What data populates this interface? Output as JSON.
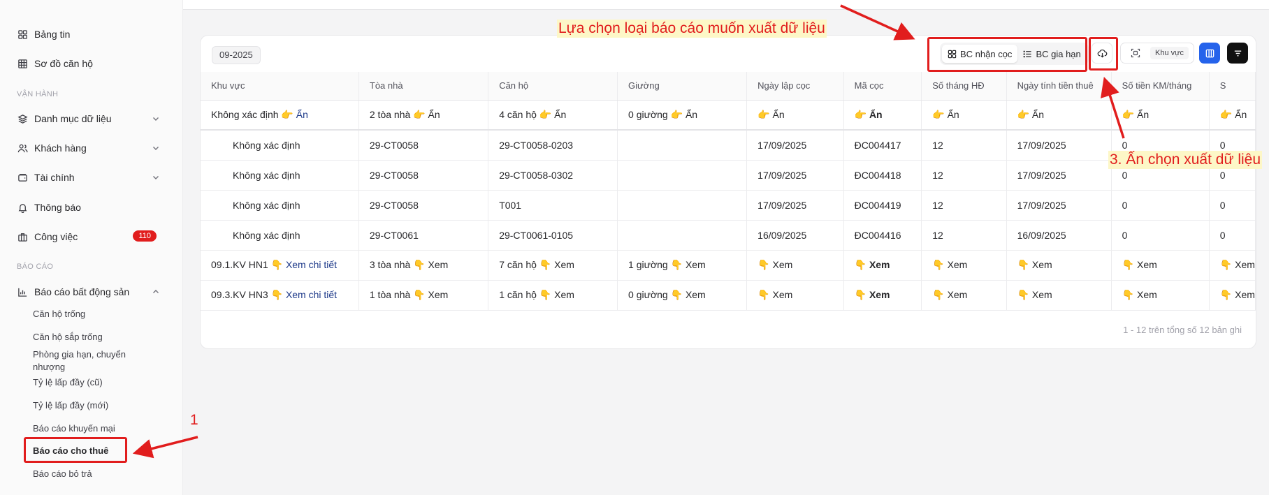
{
  "sidebar": {
    "items": [
      {
        "label": "Bảng tin"
      },
      {
        "label": "Sơ đồ căn hộ"
      }
    ],
    "sections": {
      "operations": "VẬN HÀNH",
      "reports": "BÁO CÁO"
    },
    "ops_items": [
      {
        "label": "Danh mục dữ liệu"
      },
      {
        "label": "Khách hàng"
      },
      {
        "label": "Tài chính"
      },
      {
        "label": "Thông báo"
      },
      {
        "label": "Công việc",
        "badge": "110"
      }
    ],
    "report_group": "Báo cáo bất động sản",
    "report_sub": [
      "Căn hộ trống",
      "Căn hộ sắp trống",
      "Phòng gia hạn, chuyển nhượng",
      "Tỷ lệ lấp đầy (cũ)",
      "Tỷ lệ lấp đầy (mới)",
      "Báo cáo khuyến mại",
      "Báo cáo cho thuê",
      "Báo cáo bỏ trả"
    ]
  },
  "toolbar": {
    "period": "09-2025",
    "seg_deposit": "BC nhận cọc",
    "seg_extend": "BC gia hạn",
    "region_chip": "Khu vực"
  },
  "table": {
    "headers": [
      "Khu vực",
      "Tòa nhà",
      "Căn hộ",
      "Giường",
      "Ngày lập cọc",
      "Mã cọc",
      "Số tháng HĐ",
      "Ngày tính tiền thuê",
      "Số tiền KM/tháng",
      "S"
    ],
    "summary1": {
      "area": "Không xác định",
      "area_link": "Ẩn",
      "building": "2 tòa nhà",
      "apartment": "4 căn hộ",
      "bed": "0 giường",
      "hide": "Ẩn",
      "point_left": "👉",
      "point_down": "👇"
    },
    "rows": [
      [
        "Không xác định",
        "29-CT0058",
        "29-CT0058-0203",
        "",
        "17/09/2025",
        "ĐC004417",
        "12",
        "17/09/2025",
        "0",
        "0"
      ],
      [
        "Không xác định",
        "29-CT0058",
        "29-CT0058-0302",
        "",
        "17/09/2025",
        "ĐC004418",
        "12",
        "17/09/2025",
        "0",
        "0"
      ],
      [
        "Không xác định",
        "29-CT0058",
        "T001",
        "",
        "17/09/2025",
        "ĐC004419",
        "12",
        "17/09/2025",
        "0",
        "0"
      ],
      [
        "Không xác định",
        "29-CT0061",
        "29-CT0061-0105",
        "",
        "16/09/2025",
        "ĐC004416",
        "12",
        "16/09/2025",
        "0",
        "0"
      ]
    ],
    "summary2": {
      "area": "09.1.KV HN1",
      "area_link": "Xem chi tiết",
      "building": "3 tòa nhà",
      "apartment": "7 căn hộ",
      "bed": "1 giường",
      "view": "Xem"
    },
    "summary3": {
      "area": "09.3.KV HN3",
      "area_link": "Xem chi tiết",
      "building": "1 tòa nhà",
      "apartment": "1 căn hộ",
      "bed": "0 giường",
      "view": "Xem"
    },
    "pagination": "1 - 12 trên tổng số 12 bản ghi"
  },
  "annotations": {
    "choose_type": "Lựa chọn loại báo cáo muốn xuất dữ liệu",
    "step1": "1",
    "step3": "3. Ấn chọn xuất dữ liệu"
  },
  "colors": {
    "accent_blue": "#2563eb",
    "badge_red": "#e11d1d",
    "annotation_red": "#e11d1d"
  }
}
